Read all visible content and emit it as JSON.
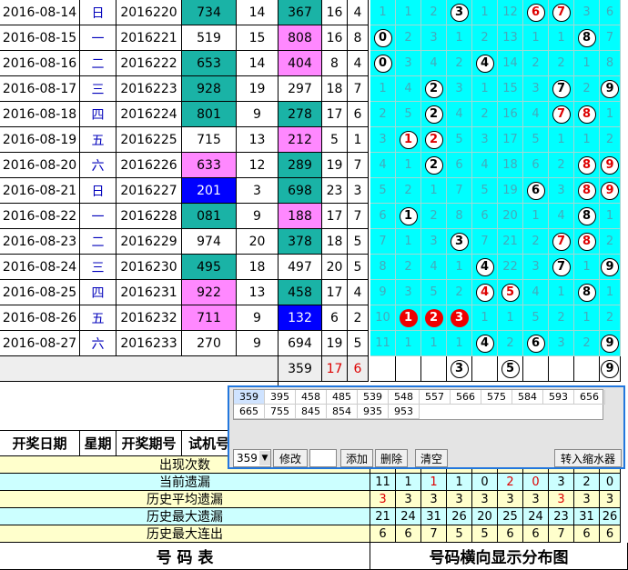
{
  "draws": [
    {
      "date": "2016-08-14",
      "weekday": "日",
      "issue": "2016220",
      "trial": "734",
      "span": "14",
      "win": "367",
      "sum": "16",
      "odd": "4",
      "trial_color": "teal",
      "win_color": "teal",
      "dist": [
        "1",
        "1",
        "2",
        "3",
        "1",
        "12",
        "6",
        "7",
        "3",
        "6"
      ]
    },
    {
      "date": "2016-08-15",
      "weekday": "一",
      "issue": "2016221",
      "trial": "519",
      "span": "15",
      "win": "808",
      "sum": "16",
      "odd": "8",
      "trial_color": "",
      "win_color": "pink",
      "dist": [
        "0",
        "2",
        "3",
        "1",
        "2",
        "13",
        "1",
        "1",
        "8",
        "7"
      ]
    },
    {
      "date": "2016-08-16",
      "weekday": "二",
      "issue": "2016222",
      "trial": "653",
      "span": "14",
      "win": "404",
      "sum": "8",
      "odd": "4",
      "trial_color": "teal",
      "win_color": "pink",
      "dist": [
        "0",
        "3",
        "4",
        "2",
        "4",
        "14",
        "2",
        "2",
        "1",
        "8"
      ]
    },
    {
      "date": "2016-08-17",
      "weekday": "三",
      "issue": "2016223",
      "trial": "928",
      "span": "19",
      "win": "297",
      "sum": "18",
      "odd": "7",
      "trial_color": "teal",
      "win_color": "",
      "dist": [
        "1",
        "4",
        "2",
        "3",
        "1",
        "15",
        "3",
        "7",
        "2",
        "9"
      ]
    },
    {
      "date": "2016-08-18",
      "weekday": "四",
      "issue": "2016224",
      "trial": "801",
      "span": "9",
      "win": "278",
      "sum": "17",
      "odd": "6",
      "trial_color": "teal",
      "win_color": "teal",
      "dist": [
        "2",
        "5",
        "2",
        "4",
        "2",
        "16",
        "4",
        "7",
        "8",
        "1"
      ]
    },
    {
      "date": "2016-08-19",
      "weekday": "五",
      "issue": "2016225",
      "trial": "715",
      "span": "13",
      "win": "212",
      "sum": "5",
      "odd": "1",
      "trial_color": "",
      "win_color": "pink",
      "dist": [
        "3",
        "1",
        "2",
        "5",
        "3",
        "17",
        "5",
        "1",
        "1",
        "2"
      ]
    },
    {
      "date": "2016-08-20",
      "weekday": "六",
      "issue": "2016226",
      "trial": "633",
      "span": "12",
      "win": "289",
      "sum": "19",
      "odd": "7",
      "trial_color": "pink",
      "win_color": "teal",
      "dist": [
        "4",
        "1",
        "2",
        "6",
        "4",
        "18",
        "6",
        "2",
        "8",
        "9"
      ]
    },
    {
      "date": "2016-08-21",
      "weekday": "日",
      "issue": "2016227",
      "trial": "201",
      "span": "3",
      "win": "698",
      "sum": "23",
      "odd": "3",
      "trial_color": "blue",
      "win_color": "teal",
      "dist": [
        "5",
        "2",
        "1",
        "7",
        "5",
        "19",
        "6",
        "3",
        "8",
        "9"
      ]
    },
    {
      "date": "2016-08-22",
      "weekday": "一",
      "issue": "2016228",
      "trial": "081",
      "span": "9",
      "win": "188",
      "sum": "17",
      "odd": "7",
      "trial_color": "teal",
      "win_color": "pink",
      "dist": [
        "6",
        "1",
        "2",
        "8",
        "6",
        "20",
        "1",
        "4",
        "8",
        "1"
      ]
    },
    {
      "date": "2016-08-23",
      "weekday": "二",
      "issue": "2016229",
      "trial": "974",
      "span": "20",
      "win": "378",
      "sum": "18",
      "odd": "5",
      "trial_color": "",
      "win_color": "teal",
      "dist": [
        "7",
        "1",
        "3",
        "3",
        "7",
        "21",
        "2",
        "7",
        "8",
        "2"
      ]
    },
    {
      "date": "2016-08-24",
      "weekday": "三",
      "issue": "2016230",
      "trial": "495",
      "span": "18",
      "win": "497",
      "sum": "20",
      "odd": "5",
      "trial_color": "teal",
      "win_color": "",
      "dist": [
        "8",
        "2",
        "4",
        "1",
        "4",
        "22",
        "3",
        "7",
        "1",
        "9"
      ]
    },
    {
      "date": "2016-08-25",
      "weekday": "四",
      "issue": "2016231",
      "trial": "922",
      "span": "13",
      "win": "458",
      "sum": "17",
      "odd": "4",
      "trial_color": "pink",
      "win_color": "teal",
      "dist": [
        "9",
        "3",
        "5",
        "2",
        "4",
        "5",
        "4",
        "1",
        "8",
        "1"
      ]
    },
    {
      "date": "2016-08-26",
      "weekday": "五",
      "issue": "2016232",
      "trial": "711",
      "span": "9",
      "win": "132",
      "sum": "6",
      "odd": "2",
      "trial_color": "pink",
      "win_color": "blue",
      "dist": [
        "10",
        "1",
        "2",
        "3",
        "1",
        "1",
        "5",
        "2",
        "1",
        "2"
      ]
    },
    {
      "date": "2016-08-27",
      "weekday": "六",
      "issue": "2016233",
      "trial": "270",
      "span": "9",
      "win": "694",
      "sum": "19",
      "odd": "5",
      "trial_color": "",
      "win_color": "",
      "dist": [
        "11",
        "1",
        "1",
        "1",
        "4",
        "2",
        "6",
        "3",
        "2",
        "9"
      ]
    }
  ],
  "ball_map": [
    [
      "",
      "",
      "",
      "w",
      "",
      "",
      "r",
      "r",
      "",
      ""
    ],
    [
      "w",
      "",
      "",
      "",
      "",
      "",
      "",
      "",
      "w",
      ""
    ],
    [
      "w",
      "",
      "",
      "",
      "w",
      "",
      "",
      "",
      "",
      ""
    ],
    [
      "",
      "",
      "w",
      "",
      "",
      "",
      "",
      "w",
      "",
      "w"
    ],
    [
      "",
      "",
      "w",
      "",
      "",
      "",
      "",
      "r",
      "r",
      ""
    ],
    [
      "",
      "r",
      "r",
      "",
      "",
      "",
      "",
      "",
      "",
      ""
    ],
    [
      "",
      "",
      "w",
      "",
      "",
      "",
      "",
      "",
      "r",
      "r"
    ],
    [
      "",
      "",
      "",
      "",
      "",
      "",
      "w",
      "",
      "r",
      "r"
    ],
    [
      "",
      "w",
      "",
      "",
      "",
      "",
      "",
      "",
      "w",
      ""
    ],
    [
      "",
      "",
      "",
      "w",
      "",
      "",
      "",
      "r",
      "r",
      ""
    ],
    [
      "",
      "",
      "",
      "",
      "w",
      "",
      "",
      "w",
      "",
      "w"
    ],
    [
      "",
      "",
      "",
      "",
      "r",
      "r",
      "",
      "",
      "w",
      ""
    ],
    [
      "",
      "red",
      "red",
      "red",
      "",
      "",
      "",
      "",
      "",
      ""
    ],
    [
      "",
      "",
      "",
      "",
      "w",
      "",
      "w",
      "",
      "",
      "w"
    ]
  ],
  "forecast": {
    "win": "359",
    "sum": "17",
    "odd": "6",
    "balls": [
      "",
      "",
      "",
      "3",
      "",
      "5",
      "",
      "",
      "",
      "9"
    ]
  },
  "header": {
    "date": "开奖日期",
    "weekday": "星期",
    "issue": "开奖期号",
    "trial": "试机号"
  },
  "stats": [
    {
      "label": "出现次数",
      "values": [
        "",
        "",
        "",
        "",
        "",
        "",
        "",
        "",
        "",
        ""
      ],
      "color": "#ffffcc"
    },
    {
      "label": "当前遗漏",
      "values": [
        "11",
        "1",
        "1",
        "1",
        "0",
        "2",
        "0",
        "3",
        "2",
        "0"
      ],
      "color": "#ccffff"
    },
    {
      "label": "历史平均遗漏",
      "values": [
        "3",
        "3",
        "3",
        "3",
        "3",
        "3",
        "3",
        "3",
        "3",
        "3"
      ],
      "color": "#ffffcc"
    },
    {
      "label": "历史最大遗漏",
      "values": [
        "21",
        "24",
        "31",
        "26",
        "20",
        "25",
        "24",
        "23",
        "31",
        "26"
      ],
      "color": "#ccffff"
    },
    {
      "label": "历史最大连出",
      "values": [
        "6",
        "6",
        "7",
        "5",
        "5",
        "6",
        "6",
        "7",
        "6",
        "6"
      ],
      "color": "#ffffcc"
    }
  ],
  "footer": {
    "left": "号  码  表",
    "right": "号码横向显示分布图"
  },
  "panel": {
    "numbers": [
      "359",
      "395",
      "458",
      "485",
      "539",
      "548",
      "557",
      "566",
      "575",
      "584",
      "593",
      "656",
      "665",
      "755",
      "845",
      "854",
      "935",
      "953"
    ],
    "combo": "359",
    "edit": "修改",
    "add": "添加",
    "delete": "删除",
    "clear": "清空",
    "transfer": "转入缩水器"
  },
  "colors": {
    "teal": "#1ab3a6",
    "pink": "#ff88ff",
    "blue": "#0000ff",
    "cyan": "#00ffff"
  }
}
